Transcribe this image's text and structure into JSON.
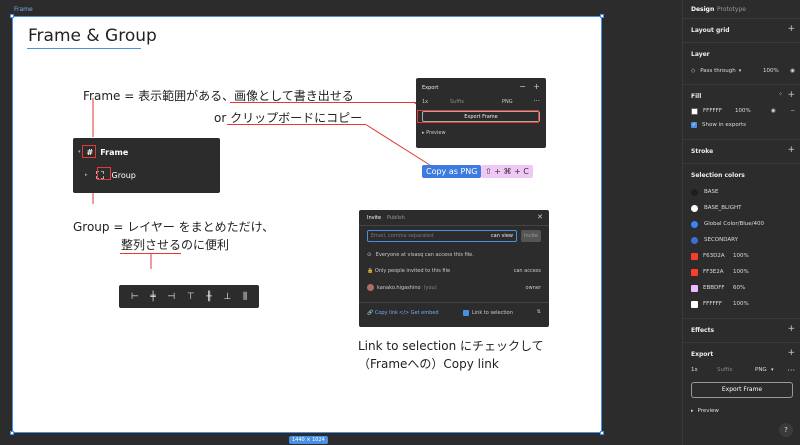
{
  "canvas": {
    "frame_label": "Frame",
    "frame_size": "1440 × 1024",
    "title": "Frame & Group",
    "line1": "Frame = 表示範囲がある、画像として書き出せる",
    "line2": "or クリップボードにコピー",
    "line3": "Group = レイヤー をまとめただけ、",
    "line4": "整列させるのに便利",
    "caption1": "Link to selection にチェックして",
    "caption2": "（Frameへの）Copy link",
    "layers_panel": {
      "frame_name": "Frame",
      "group_name": "Group",
      "frame_glyph": "#"
    },
    "copy_as_png": "Copy as PNG",
    "shortcut": "⇧ + ⌘ + C",
    "export_panel": {
      "title": "Export",
      "scale": "1x",
      "suffix": "Suffix",
      "format": "PNG",
      "button": "Export Frame",
      "preview": "Preview"
    },
    "invite_panel": {
      "tab_invite": "Invite",
      "tab_publish": "Publish",
      "email_placeholder": "Email, comma separated",
      "perm": "can view",
      "invite_btn": "Invite",
      "row1": "Everyone at visasq can access this file.",
      "row2": "Only people invited to this file",
      "row2_right": "can access",
      "row3": "kanako.higashino",
      "row3_you": "(you)",
      "row3_right": "owner",
      "copy_link": "Copy link",
      "get_embed": "Get embed",
      "link_to_selection": "Link to selection"
    }
  },
  "panel": {
    "tab_design": "Design",
    "tab_prototype": "Prototype",
    "layout_grid": "Layout grid",
    "layer": "Layer",
    "pass_through": "Pass through",
    "layer_opacity": "100%",
    "fill": "Fill",
    "fill_hex": "FFFFFF",
    "fill_opacity": "100%",
    "show_in_exports": "Show in exports",
    "stroke": "Stroke",
    "selection_colors": "Selection colors",
    "colors": [
      {
        "name": "BASE",
        "color": "#1e1e1e",
        "round": true,
        "opacity": ""
      },
      {
        "name": "BASE_BLIGHT",
        "color": "#ffffff",
        "round": true,
        "opacity": ""
      },
      {
        "name": "Global Color/Blue/400",
        "color": "#3b82f6",
        "round": true,
        "opacity": ""
      },
      {
        "name": "SECONDARY",
        "color": "#3b6fd6",
        "round": true,
        "opacity": ""
      },
      {
        "name": "F63D2A",
        "color": "#F63D2A",
        "round": false,
        "opacity": "100%"
      },
      {
        "name": "FF3E2A",
        "color": "#FF3E2A",
        "round": false,
        "opacity": "100%"
      },
      {
        "name": "EBBDFF",
        "color": "#EBBDFF",
        "round": false,
        "opacity": "60%"
      },
      {
        "name": "FFFFFF",
        "color": "#FFFFFF",
        "round": false,
        "opacity": "100%"
      }
    ],
    "effects": "Effects",
    "export": "Export",
    "export_scale": "1x",
    "export_suffix": "Suffix",
    "export_format": "PNG",
    "export_button": "Export Frame",
    "preview": "Preview",
    "help": "?"
  }
}
